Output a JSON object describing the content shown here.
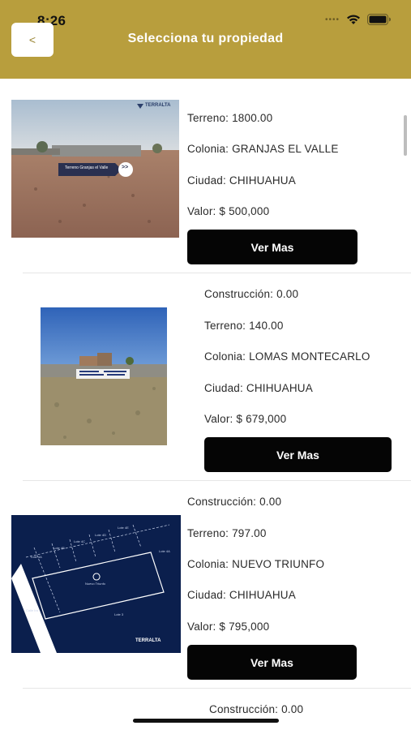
{
  "status_bar": {
    "time": "8:26",
    "signal_icon": "signal-dots-icon",
    "wifi_icon": "wifi-icon",
    "battery_icon": "battery-icon"
  },
  "header": {
    "back_label": "<",
    "title": "Selecciona tu propiedad"
  },
  "colors": {
    "header": "#b89e3d",
    "button": "#050505",
    "separator": "#e6e6e6"
  },
  "listings": [
    {
      "photo_caption": "Terreno Granjas el Valle",
      "photo_arrow": ">>",
      "photo_brand": "TERRALTA",
      "terreno": "Terreno: 1800.00",
      "colonia": "Colonia: GRANJAS EL VALLE",
      "ciudad": "Ciudad: CHIHUAHUA",
      "valor": "Valor: $ 500,000",
      "button": "Ver Mas"
    },
    {
      "construccion": "Construcción: 0.00",
      "terreno": "Terreno: 140.00",
      "colonia": "Colonia: LOMAS MONTECARLO",
      "ciudad": "Ciudad: CHIHUAHUA",
      "valor": "Valor: $ 679,000",
      "button": "Ver Mas"
    },
    {
      "photo_brand": "TERRALTA",
      "plan_labels": [
        "Lote 4A",
        "Lote 4B",
        "Lote 4C",
        "Lote 4D",
        "Lote 4E",
        "Lote 4A",
        "Nuevo Triunfo",
        "Calle Ira",
        "Lote 3"
      ],
      "construccion": "Construcción: 0.00",
      "terreno": "Terreno: 797.00",
      "colonia": "Colonia: NUEVO TRIUNFO",
      "ciudad": "Ciudad: CHIHUAHUA",
      "valor": "Valor: $ 795,000",
      "button": "Ver Mas"
    },
    {
      "construccion": "Construcción: 0.00"
    }
  ]
}
